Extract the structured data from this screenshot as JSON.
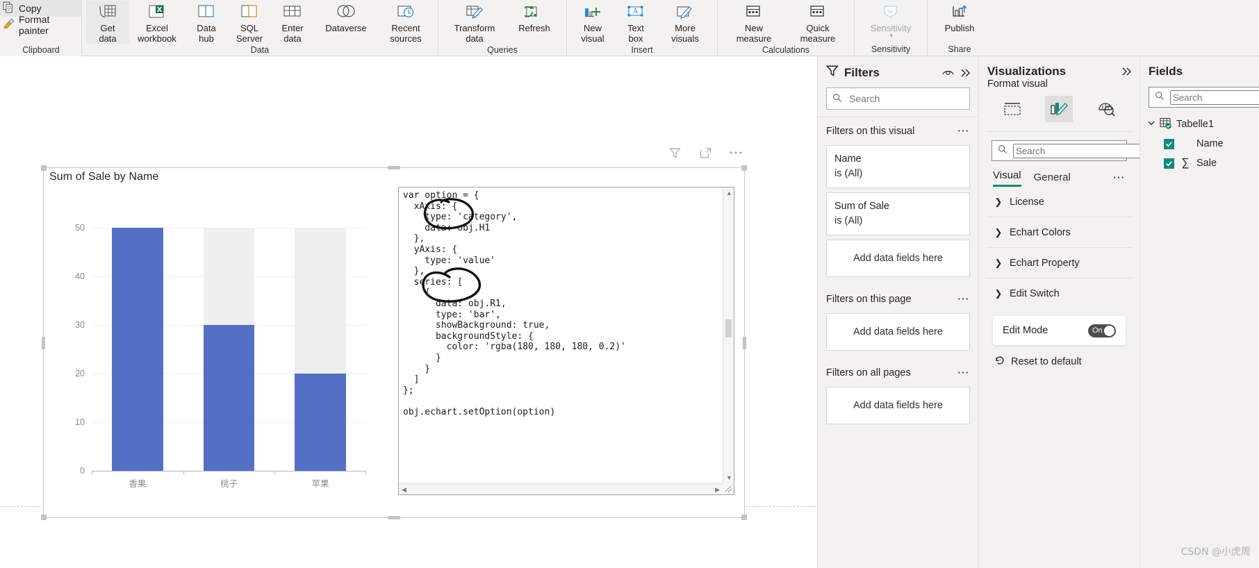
{
  "ribbon": {
    "clipboard": {
      "group_label": "Clipboard",
      "items": [
        {
          "label": "Copy",
          "icon": "copy-icon"
        },
        {
          "label": "Format painter",
          "icon": "format-painter-icon"
        }
      ]
    },
    "groups": [
      {
        "name": "data",
        "group_label": "Data",
        "items": [
          {
            "label": "Get\ndata",
            "icon": "get-data-icon",
            "dropdown": true,
            "active": true
          },
          {
            "label": "Excel\nworkbook",
            "icon": "excel-workbook-icon",
            "dropdown": false
          },
          {
            "label": "Data\nhub",
            "icon": "data-hub-icon",
            "dropdown": true
          },
          {
            "label": "SQL\nServer",
            "icon": "sql-server-icon",
            "dropdown": false
          },
          {
            "label": "Enter\ndata",
            "icon": "enter-data-icon",
            "dropdown": false
          },
          {
            "label": "Dataverse",
            "icon": "dataverse-icon",
            "dropdown": false
          },
          {
            "label": "Recent\nsources",
            "icon": "recent-sources-icon",
            "dropdown": true
          }
        ]
      },
      {
        "name": "queries",
        "group_label": "Queries",
        "items": [
          {
            "label": "Transform\ndata",
            "icon": "transform-data-icon",
            "dropdown": true
          },
          {
            "label": "Refresh",
            "icon": "refresh-icon",
            "dropdown": false
          }
        ]
      },
      {
        "name": "insert",
        "group_label": "Insert",
        "items": [
          {
            "label": "New\nvisual",
            "icon": "new-visual-icon",
            "dropdown": false
          },
          {
            "label": "Text\nbox",
            "icon": "text-box-icon",
            "dropdown": false
          },
          {
            "label": "More\nvisuals",
            "icon": "more-visuals-icon",
            "dropdown": true
          }
        ]
      },
      {
        "name": "calculations",
        "group_label": "Calculations",
        "items": [
          {
            "label": "New\nmeasure",
            "icon": "new-measure-icon",
            "dropdown": false
          },
          {
            "label": "Quick\nmeasure",
            "icon": "quick-measure-icon",
            "dropdown": false
          }
        ]
      },
      {
        "name": "sensitivity",
        "group_label": "Sensitivity",
        "items": [
          {
            "label": "Sensitivity",
            "icon": "sensitivity-icon",
            "dropdown": true,
            "disabled": true
          }
        ]
      },
      {
        "name": "share",
        "group_label": "Share",
        "items": [
          {
            "label": "Publish",
            "icon": "publish-icon",
            "dropdown": false
          }
        ]
      }
    ]
  },
  "visual": {
    "header_icons": [
      "filter-icon",
      "focus-mode-icon",
      "more-options-icon"
    ],
    "title": "Sum of Sale by Name",
    "code": {
      "lines": [
        "var option = {",
        "  xAxis: {",
        "    type: 'category',",
        "    data: obj.H1",
        "  },",
        "  yAxis: {",
        "    type: 'value'",
        "  },",
        "  series: [",
        "    {",
        "      data: obj.R1,",
        "      type: 'bar',",
        "      showBackground: true,",
        "      backgroundStyle: {",
        "        color: 'rgba(180, 180, 180, 0.2)'",
        "      }",
        "    }",
        "  ]",
        "};",
        "",
        "obj.echart.setOption(option)"
      ]
    }
  },
  "chart_data": {
    "type": "bar",
    "title": "Sum of Sale by Name",
    "categories": [
      "香果",
      "桃子",
      "苹果"
    ],
    "values": [
      50,
      30,
      20
    ],
    "series": [
      {
        "name": "Sum of Sale",
        "values": [
          50,
          30,
          20
        ],
        "color": "#5470c6"
      }
    ],
    "background_bars": {
      "enabled": true,
      "value": 50,
      "color": "#efefef"
    },
    "yticks": [
      0,
      10,
      20,
      30,
      40,
      50
    ],
    "ylim": [
      0,
      50
    ],
    "xlabel": "",
    "ylabel": "",
    "grid": true,
    "legend": "none"
  },
  "filters_pane": {
    "title": "Filters",
    "search_placeholder": "Search",
    "sections": [
      {
        "label": "Filters on this visual",
        "cards": [
          {
            "field": "Name",
            "condition": "is (All)"
          },
          {
            "field": "Sum of Sale",
            "condition": "is (All)"
          }
        ],
        "dropzone": "Add data fields here"
      },
      {
        "label": "Filters on this page",
        "cards": [],
        "dropzone": "Add data fields here"
      },
      {
        "label": "Filters on all pages",
        "cards": [],
        "dropzone": "Add data fields here"
      }
    ]
  },
  "visualizations_pane": {
    "title": "Visualizations",
    "subtitle": "Format visual",
    "format_icons": [
      {
        "name": "build-visual-icon",
        "selected": false
      },
      {
        "name": "format-visual-icon",
        "selected": true
      },
      {
        "name": "analytics-icon",
        "selected": false
      }
    ],
    "search_placeholder": "Search",
    "tabs": [
      {
        "label": "Visual",
        "selected": true
      },
      {
        "label": "General",
        "selected": false
      }
    ],
    "sections": [
      {
        "label": "License",
        "expanded": false
      },
      {
        "label": "Echart Colors",
        "expanded": false
      },
      {
        "label": "Echart Property",
        "expanded": false
      },
      {
        "label": "Edit Switch",
        "expanded": true
      }
    ],
    "edit_mode": {
      "label": "Edit Mode",
      "state": "On"
    },
    "reset_label": "Reset to default"
  },
  "fields_pane": {
    "title": "Fields",
    "search_placeholder": "Search",
    "table": "Tabelle1",
    "fields": [
      {
        "label": "Name",
        "checked": true,
        "aggregate": false
      },
      {
        "label": "Sale",
        "checked": true,
        "aggregate": true,
        "sigma": "∑"
      }
    ]
  },
  "watermark": "CSDN @小虎周",
  "colors": {
    "bar": "#5470c6",
    "bar_background": "#efefef",
    "accent_teal": "#118a7e",
    "ribbon_bg": "#f3f2f1",
    "pane_bg": "#f3f2f1"
  }
}
